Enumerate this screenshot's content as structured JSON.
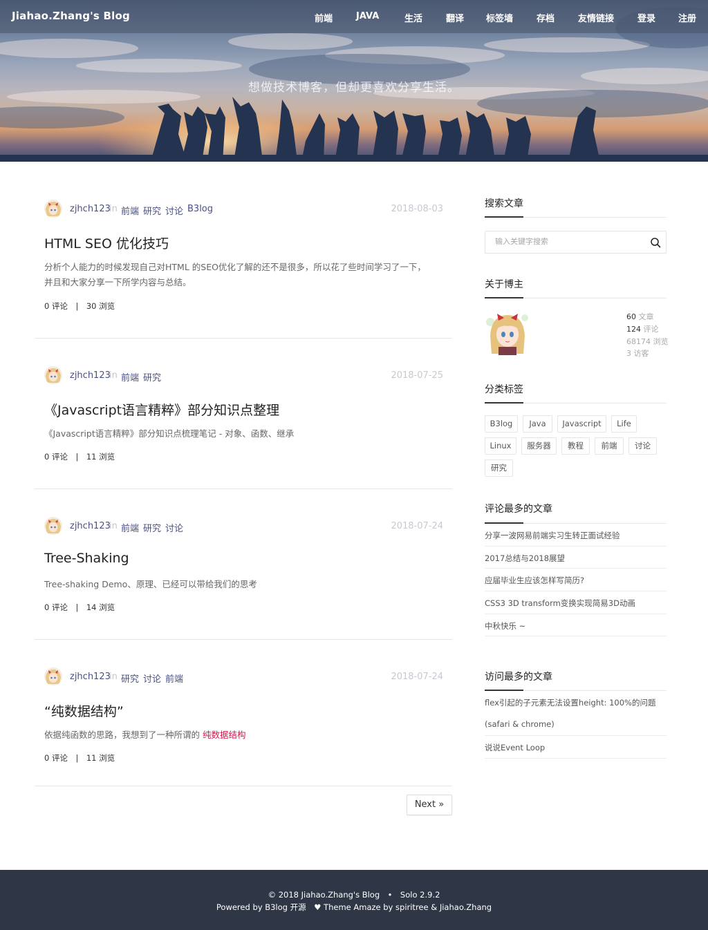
{
  "header": {
    "brand": "Jiahao.Zhang's Blog",
    "nav": [
      {
        "label": "前端"
      },
      {
        "label": "JAVA"
      },
      {
        "label": "生活"
      },
      {
        "label": "翻译"
      },
      {
        "label": "标签墙"
      },
      {
        "label": "存档"
      },
      {
        "label": "友情链接"
      },
      {
        "label": "登录"
      },
      {
        "label": "注册"
      }
    ],
    "tagline": "想做技术博客，但却更喜欢分享生活。"
  },
  "posts": [
    {
      "author": "zjhch123",
      "in": "in",
      "tags": [
        "前端",
        "研究",
        "讨论",
        "B3log"
      ],
      "date": "2018-08-03",
      "title": "HTML SEO 优化技巧",
      "abstract_line1": "分析个人能力的时候发现自己对HTML 的SEO优化了解的还不是很多，所以花了些时间学习了一下，",
      "abstract_line2": "并且和大家分享一下所学内容与总结。",
      "stats": "0 评论　|　30 浏览"
    },
    {
      "author": "zjhch123",
      "in": "in",
      "tags": [
        "前端",
        "研究"
      ],
      "date": "2018-07-25",
      "title": "《Javascript语言精粹》部分知识点整理",
      "abstract_line1": "《Javascript语言精粹》部分知识点梳理笔记 - 对象、函数、继承",
      "stats": "0 评论　|　11 浏览"
    },
    {
      "author": "zjhch123",
      "in": "in",
      "tags": [
        "前端",
        "研究",
        "讨论"
      ],
      "date": "2018-07-24",
      "title": "Tree-Shaking",
      "abstract_line1": "Tree-shaking Demo、原理、已经可以带给我们的思考",
      "stats": "0 评论　|　14 浏览"
    },
    {
      "author": "zjhch123",
      "in": "in",
      "tags": [
        "研究",
        "讨论",
        "前端"
      ],
      "date": "2018-07-24",
      "title": "“纯数据结构”",
      "abstract_line1": "依据纯函数的思路，我想到了一种所谓的 ",
      "abstract_highlight": "纯数据结构",
      "stats": "0 评论　|　11 浏览"
    }
  ],
  "pagination": {
    "next_label": "Next »"
  },
  "sidebar": {
    "search": {
      "title": "搜索文章",
      "placeholder": "输入关键字搜索"
    },
    "about": {
      "title": "关于博主",
      "stats": [
        {
          "value": "60",
          "label": "文章"
        },
        {
          "value": "124",
          "label": "评论"
        },
        {
          "value": "68174",
          "label": "浏览"
        },
        {
          "value": "3",
          "label": "访客"
        }
      ]
    },
    "tags": {
      "title": "分类标签",
      "items": [
        "B3log",
        "Java",
        "Javascript",
        "Life",
        "Linux",
        "服务器",
        "教程",
        "前端",
        "讨论",
        "研究"
      ]
    },
    "most_commented": {
      "title": "评论最多的文章",
      "items": [
        "分享一波网易前端实习生转正面试经验",
        "2017总结与2018展望",
        "应届毕业生应该怎样写简历?",
        "CSS3 3D transform变换实现简易3D动画",
        "中秋快乐 ~"
      ]
    },
    "most_viewed": {
      "title": "访问最多的文章",
      "items": [
        "flex引起的子元素无法设置height: 100%的问题",
        "(safari & chrome)",
        "说说Event Loop"
      ]
    }
  },
  "footer": {
    "line1": "© 2018 Jiahao.Zhang's Blog　•　Solo 2.9.2",
    "line2": "Powered by B3log 开源　♥ Theme Amaze by spiritree & Jiahao.Zhang"
  }
}
